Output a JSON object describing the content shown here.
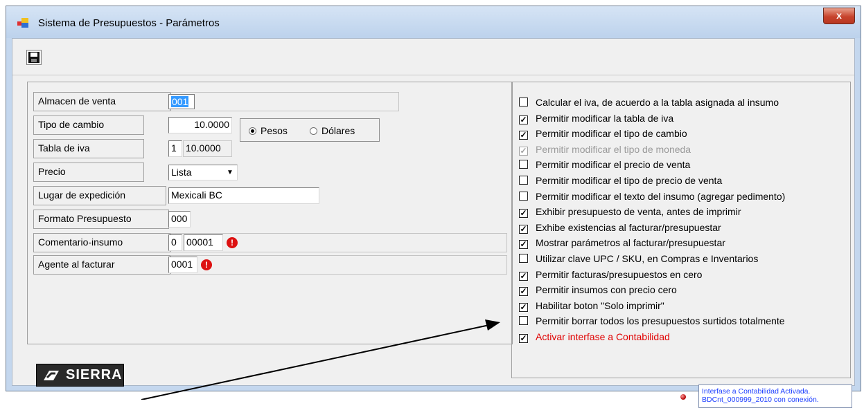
{
  "window": {
    "title": "Sistema de Presupuestos - Parámetros",
    "close_label": "x"
  },
  "toolbar": {
    "save_icon": "floppy-disk-icon"
  },
  "form": {
    "almacen": {
      "label": "Almacen de venta",
      "value": "001"
    },
    "tipo_cambio": {
      "label": "Tipo de cambio",
      "value": "10.0000"
    },
    "moneda": {
      "option1": "Pesos",
      "option2": "Dólares",
      "selected": "Pesos"
    },
    "tabla_iva": {
      "label": "Tabla de iva",
      "num": "1",
      "value": "10.0000"
    },
    "precio": {
      "label": "Precio",
      "value": "Lista"
    },
    "lugar": {
      "label": "Lugar de expedición",
      "value": "Mexicali BC"
    },
    "formato": {
      "label": "Formato Presupuesto",
      "value": "000"
    },
    "comentario": {
      "label": "Comentario-insumo",
      "num": "0",
      "value": "00001"
    },
    "agente": {
      "label": "Agente al facturar",
      "value": "0001"
    }
  },
  "options": [
    {
      "label": "Calcular el iva, de acuerdo a la tabla asignada al insumo",
      "checked": false
    },
    {
      "label": "Permitir modificar la tabla de iva",
      "checked": true
    },
    {
      "label": "Permitir modificar el tipo de cambio",
      "checked": true
    },
    {
      "label": "Permitir modificar el tipo de moneda",
      "checked": true,
      "disabled": true
    },
    {
      "label": "Permitir modificar el precio de venta",
      "checked": false
    },
    {
      "label": "Permitir modificar el tipo de precio de venta",
      "checked": false
    },
    {
      "label": "Permitir modificar el texto del insumo (agregar pedimento)",
      "checked": false
    },
    {
      "label": "Exhibir presupuesto de venta, antes de imprimir",
      "checked": true
    },
    {
      "label": "Exhibe existencias al facturar/presupuestar",
      "checked": true
    },
    {
      "label": "Mostrar  parámetros al facturar/presupuestar",
      "checked": true
    },
    {
      "label": "Utilizar clave UPC / SKU, en Compras e Inventarios",
      "checked": false
    },
    {
      "label": "Permitir facturas/presupuestos en cero",
      "checked": true
    },
    {
      "label": "Permitir insumos con precio cero",
      "checked": true
    },
    {
      "label": "Habilitar boton \"Solo imprimir\"",
      "checked": true
    },
    {
      "label": "Permitir borrar todos los presupuestos surtidos totalmente",
      "checked": false
    },
    {
      "label": "Activar interfase a Contabilidad",
      "checked": true,
      "highlight": "#e00000"
    }
  ],
  "logo": {
    "text": "SIERRA"
  },
  "status": {
    "line1": "Interfase a Contabilidad Activada.",
    "line2": "BDCnt_000999_2010 con conexión."
  }
}
